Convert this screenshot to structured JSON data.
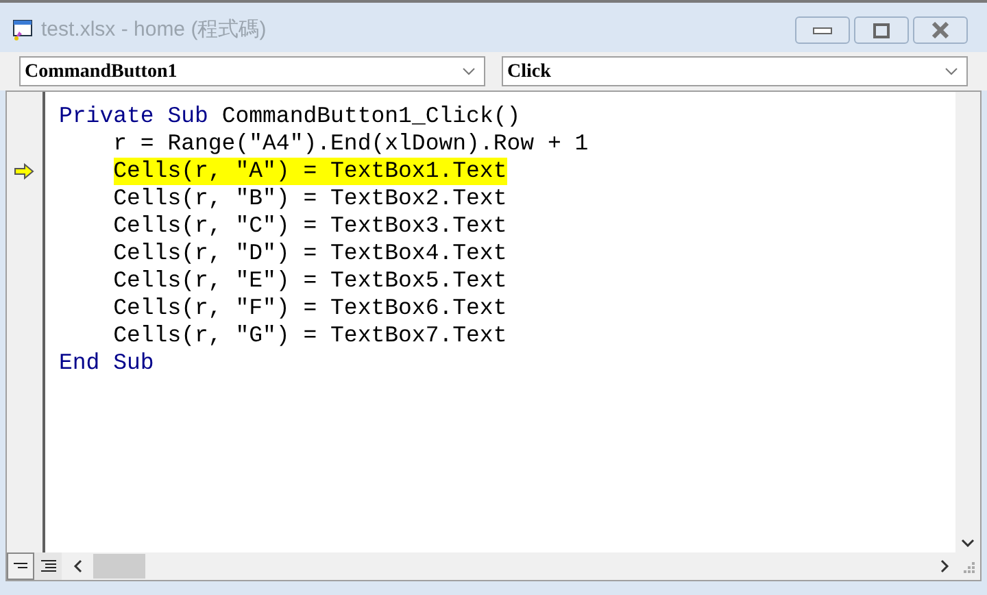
{
  "window": {
    "title": "test.xlsx - home (程式碼)"
  },
  "object_dropdown": {
    "value": "CommandButton1"
  },
  "procedure_dropdown": {
    "value": "Click"
  },
  "code": [
    {
      "tokens": [
        {
          "text": "Private",
          "kind": "keyword"
        },
        {
          "text": "Sub",
          "kind": "keyword"
        },
        {
          "text": "CommandButton1_Click()",
          "kind": "plain"
        }
      ],
      "current": false,
      "children": [
        {
          "tokens": [
            {
              "text": "r = Range(\"A4\").End(xlDown).Row + 1",
              "kind": "plain"
            }
          ],
          "current": false
        },
        {
          "tokens": [
            {
              "text": "Cells(r, \"A\") = TextBox1.Text",
              "kind": "plain"
            }
          ],
          "current": true
        },
        {
          "tokens": [
            {
              "text": "Cells(r, \"B\") = TextBox2.Text",
              "kind": "plain"
            }
          ],
          "current": false
        },
        {
          "tokens": [
            {
              "text": "Cells(r, \"C\") = TextBox3.Text",
              "kind": "plain"
            }
          ],
          "current": false
        },
        {
          "tokens": [
            {
              "text": "Cells(r, \"D\") = TextBox4.Text",
              "kind": "plain"
            }
          ],
          "current": false
        },
        {
          "tokens": [
            {
              "text": "Cells(r, \"E\") = TextBox5.Text",
              "kind": "plain"
            }
          ],
          "current": false
        },
        {
          "tokens": [
            {
              "text": "Cells(r, \"F\") = TextBox6.Text",
              "kind": "plain"
            }
          ],
          "current": false
        },
        {
          "tokens": [
            {
              "text": "Cells(r, \"G\") = TextBox7.Text",
              "kind": "plain"
            }
          ],
          "current": false
        }
      ]
    },
    {
      "tokens": [
        {
          "text": "End",
          "kind": "keyword"
        },
        {
          "text": "Sub",
          "kind": "keyword"
        }
      ],
      "current": false
    }
  ]
}
